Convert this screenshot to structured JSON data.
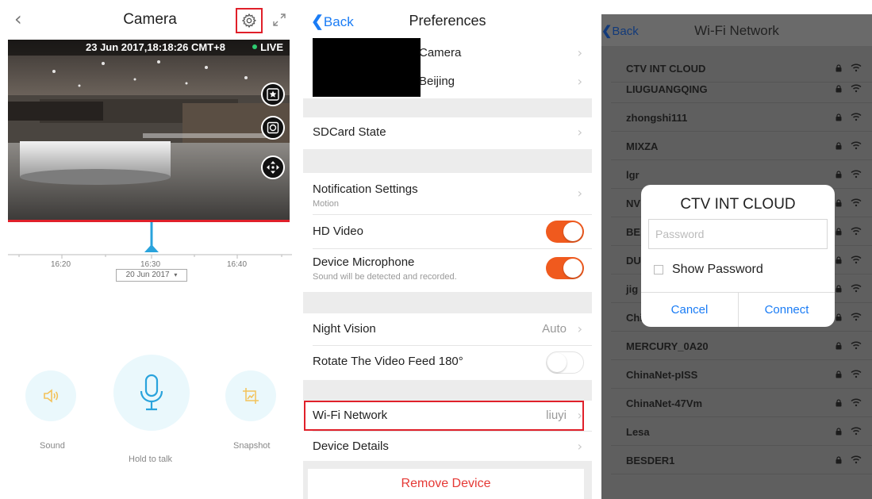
{
  "camera_screen": {
    "title": "Camera",
    "back_icon": "chevron-left-icon",
    "settings_icon": "gear-icon",
    "expand_icon": "expand-icon",
    "timestamp": "23 Jun 2017,18:18:26 CMT+8",
    "live_label": "LIVE",
    "timeline_labels": [
      "16:20",
      "16:30",
      "16:40"
    ],
    "date_selector": "20 Jun 2017",
    "controls": [
      {
        "label": "Sound",
        "icon": "speaker-icon"
      },
      {
        "label": "Hold to talk",
        "icon": "microphone-icon"
      },
      {
        "label": "Snapshot",
        "icon": "snapshot-icon"
      }
    ],
    "highlight_color": "#e0202a",
    "accent_color": "#29a3dc"
  },
  "preferences_screen": {
    "back_label": "Back",
    "title": "Preferences",
    "device_name": "Camera",
    "device_location": "Beijing",
    "sdcard_label": "SDCard State",
    "notification_label": "Notification Settings",
    "notification_sub": "Motion",
    "hd_video_label": "HD Video",
    "hd_video_on": true,
    "microphone_label": "Device Microphone",
    "microphone_sub": "Sound will be detected and recorded.",
    "microphone_on": true,
    "night_vision_label": "Night Vision",
    "night_vision_value": "Auto",
    "rotate_label": "Rotate The Video Feed 180°",
    "rotate_on": false,
    "wifi_label": "Wi-Fi Network",
    "wifi_value": "liuyi",
    "device_details_label": "Device Details",
    "remove_label": "Remove Device",
    "toggle_on_color": "#f05a1e",
    "link_color": "#1a7cf5",
    "remove_color": "#e53935"
  },
  "wifi_screen": {
    "back_label": "Back",
    "title": "Wi-Fi Network",
    "networks": [
      "CTV INT CLOUD",
      "LIUGUANGQING",
      "zhongshi111",
      "MIXZA",
      "lgr",
      "NV",
      "BE",
      "DU",
      "jig",
      "ChinaNet-7DAZ",
      "MERCURY_0A20",
      "ChinaNet-pISS",
      "ChinaNet-47Vm",
      "Lesa",
      "BESDER1"
    ],
    "dialog": {
      "title": "CTV INT CLOUD",
      "password_placeholder": "Password",
      "show_password_label": "Show Password",
      "cancel_label": "Cancel",
      "connect_label": "Connect"
    }
  }
}
